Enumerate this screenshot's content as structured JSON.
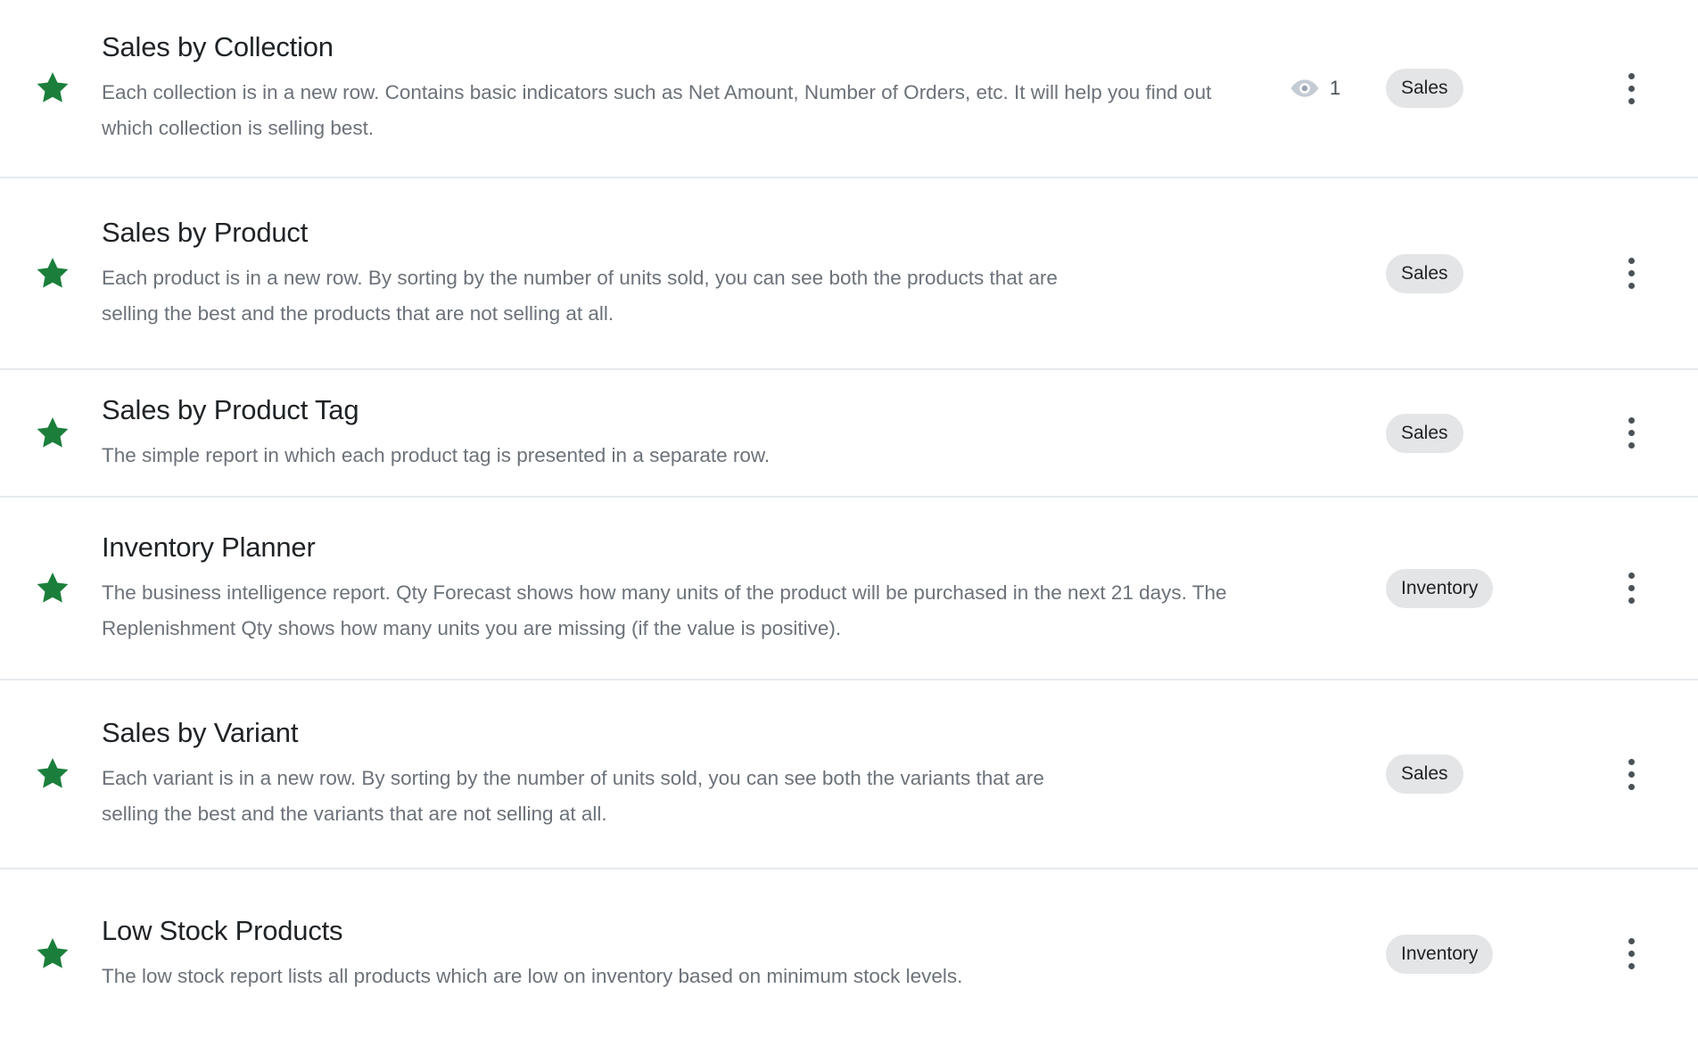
{
  "list": {
    "name": "report-templates-list",
    "rows": [
      {
        "title": "Sales by Collection",
        "description": "Each collection is in a new row. Contains basic indicators such as Net Amount, Number of Orders, etc. It will help you find out which collection is selling best.",
        "badge": "Sales",
        "views": "1",
        "starred": true,
        "star_icon": "star-icon",
        "views_icon": "eye-icon",
        "menu_icon": "kebab-menu-icon"
      },
      {
        "title": "Sales by Product",
        "description": "Each product is in a new row. By sorting by the number of units sold, you can see both the products that are selling the best and the products that are not selling at all.",
        "badge": "Sales",
        "views": "",
        "starred": true,
        "star_icon": "star-icon",
        "views_icon": "eye-icon",
        "menu_icon": "kebab-menu-icon"
      },
      {
        "title": "Sales by Product Tag",
        "description": "The simple report in which each product tag is presented in a separate row.",
        "badge": "Sales",
        "views": "",
        "starred": true,
        "star_icon": "star-icon",
        "views_icon": "eye-icon",
        "menu_icon": "kebab-menu-icon"
      },
      {
        "title": "Inventory Planner",
        "description": "The business intelligence report. Qty Forecast shows how many units of the product will be purchased in the next 21 days. The Replenishment Qty shows how many units you are missing (if the value is positive).",
        "badge": "Inventory",
        "views": "",
        "starred": true,
        "star_icon": "star-icon",
        "views_icon": "eye-icon",
        "menu_icon": "kebab-menu-icon"
      },
      {
        "title": "Sales by Variant",
        "description": "Each variant is in a new row. By sorting by the number of units sold, you can see both the variants that are selling the best and the variants that are not selling at all.",
        "badge": "Sales",
        "views": "",
        "starred": true,
        "star_icon": "star-icon",
        "views_icon": "eye-icon",
        "menu_icon": "kebab-menu-icon"
      },
      {
        "title": "Low Stock Products",
        "description": "The low stock report lists all products which are low on inventory based on minimum stock levels.",
        "badge": "Inventory",
        "views": "",
        "starred": true,
        "star_icon": "star-icon",
        "views_icon": "eye-icon",
        "menu_icon": "kebab-menu-icon"
      }
    ]
  },
  "colors": {
    "star_green": "#1b7f3b",
    "badge_background": "#e4e5e7",
    "badge_text": "#202223",
    "title_text": "#1f2326",
    "description_text": "#6c727a",
    "divider": "#e6eaee",
    "eye_icon": "#c4cbd4",
    "kebab_dot": "#4b5257",
    "page_background": "#ffffff"
  }
}
